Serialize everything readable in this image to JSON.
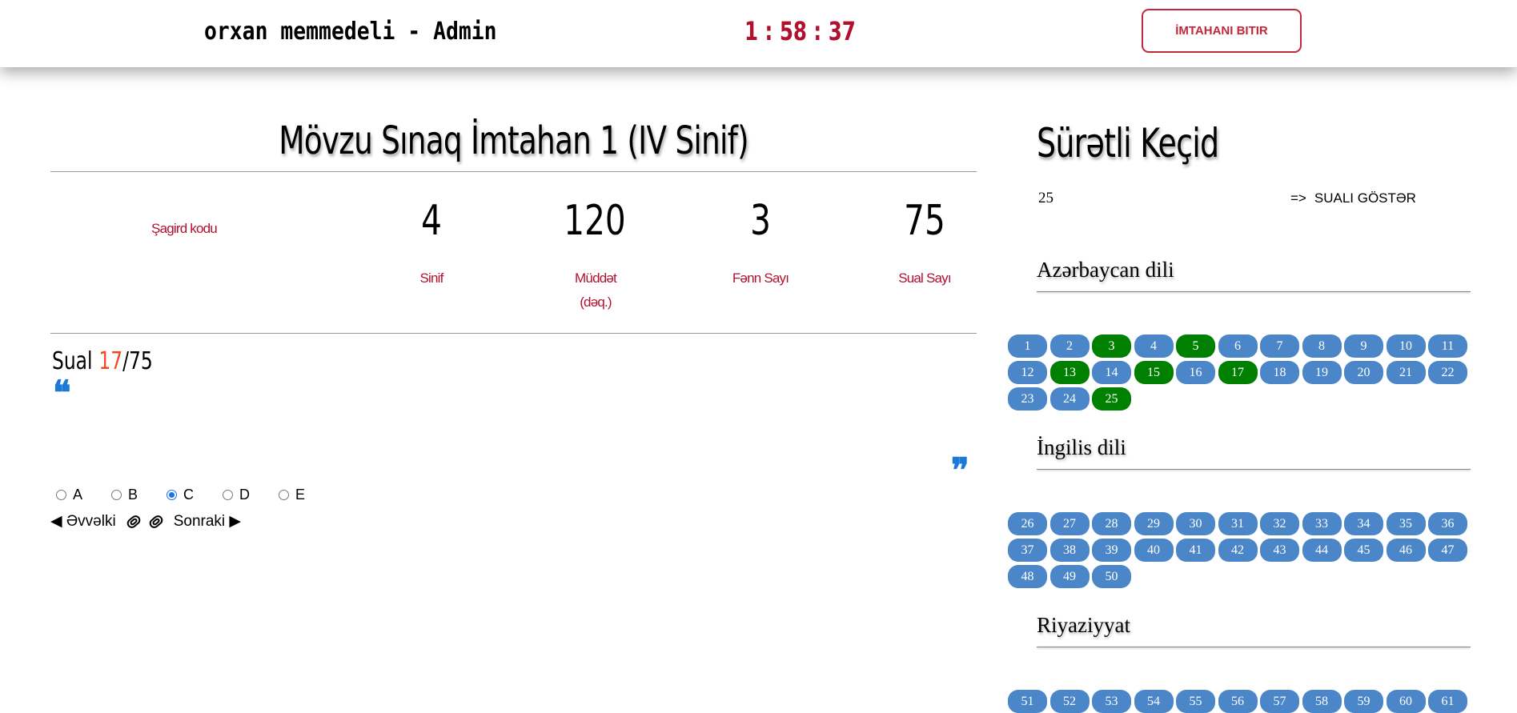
{
  "header": {
    "user": "orxan memmedeli - Admin",
    "timer": "1 : 58 : 37",
    "finish_label": "İMTAHANI BITIR"
  },
  "exam": {
    "title": "Mövzu Sınaq İmtahan 1 (IV Sinif)",
    "code_label": "Şagird kodu",
    "stats": [
      {
        "value": "4",
        "label": "Sinif"
      },
      {
        "value": "120",
        "label": "Müddət (dəq.)"
      },
      {
        "value": "3",
        "label": "Fənn Sayı"
      },
      {
        "value": "75",
        "label": "Sual Sayı"
      }
    ]
  },
  "question": {
    "prefix": "Sual",
    "current": "17",
    "total": "/75",
    "options": [
      {
        "label": "A",
        "selected": false
      },
      {
        "label": "B",
        "selected": false
      },
      {
        "label": "C",
        "selected": true
      },
      {
        "label": "D",
        "selected": false
      },
      {
        "label": "E",
        "selected": false
      }
    ],
    "prev_label": "◀ Əvvəlki",
    "next_label": "Sonraki ▶"
  },
  "quicknav": {
    "title": "Sürətli Keçid",
    "input_value": "25",
    "arrow": "=>",
    "show_label": "SUALI GÖSTƏR",
    "subjects": [
      {
        "name": "Azərbaycan dili",
        "questions": [
          "1",
          "2",
          "3",
          "4",
          "5",
          "6",
          "7",
          "8",
          "9",
          "10",
          "11",
          "12",
          "13",
          "14",
          "15",
          "16",
          "17",
          "18",
          "19",
          "20",
          "21",
          "22",
          "23",
          "24",
          "25"
        ],
        "answered": [
          "3",
          "5",
          "13",
          "15",
          "17",
          "25"
        ]
      },
      {
        "name": "İngilis dili",
        "questions": [
          "26",
          "27",
          "28",
          "29",
          "30",
          "31",
          "32",
          "33",
          "34",
          "35",
          "36",
          "37",
          "38",
          "39",
          "40",
          "41",
          "42",
          "43",
          "44",
          "45",
          "46",
          "47",
          "48",
          "49",
          "50"
        ],
        "answered": []
      },
      {
        "name": "Riyaziyyat",
        "questions": [
          "51",
          "52",
          "53",
          "54",
          "55",
          "56",
          "57",
          "58",
          "59",
          "60",
          "61"
        ],
        "answered": []
      }
    ]
  },
  "colors": {
    "accent_red": "#b2102f",
    "button_blue": "#4a86c8",
    "answered_green": "#008000",
    "quote_blue": "#1c7ad6",
    "current_orange": "#ef4a22"
  }
}
